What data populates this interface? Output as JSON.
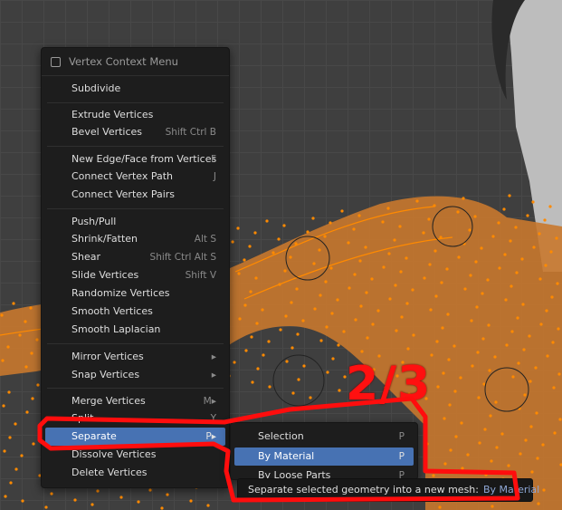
{
  "context_menu": {
    "title": "Vertex Context Menu",
    "items": [
      {
        "label": "Subdivide",
        "shortcut": ""
      },
      {
        "label": "Extrude Vertices",
        "shortcut": ""
      },
      {
        "label": "Bevel Vertices",
        "shortcut": "Shift Ctrl B"
      },
      {
        "label": "New Edge/Face from Vertices",
        "shortcut": "F"
      },
      {
        "label": "Connect Vertex Path",
        "shortcut": "J"
      },
      {
        "label": "Connect Vertex Pairs",
        "shortcut": ""
      },
      {
        "label": "Push/Pull",
        "shortcut": ""
      },
      {
        "label": "Shrink/Fatten",
        "shortcut": "Alt S"
      },
      {
        "label": "Shear",
        "shortcut": "Shift Ctrl Alt S"
      },
      {
        "label": "Slide Vertices",
        "shortcut": "Shift V"
      },
      {
        "label": "Randomize Vertices",
        "shortcut": ""
      },
      {
        "label": "Smooth Vertices",
        "shortcut": ""
      },
      {
        "label": "Smooth Laplacian",
        "shortcut": ""
      },
      {
        "label": "Mirror Vertices",
        "shortcut": "▸"
      },
      {
        "label": "Snap Vertices",
        "shortcut": "▸"
      },
      {
        "label": "Merge Vertices",
        "shortcut": "M▸"
      },
      {
        "label": "Split",
        "shortcut": "Y"
      },
      {
        "label": "Separate",
        "shortcut": "P▸"
      },
      {
        "label": "Dissolve Vertices",
        "shortcut": ""
      },
      {
        "label": "Delete Vertices",
        "shortcut": ""
      }
    ]
  },
  "separate_submenu": {
    "items": [
      {
        "label": "Selection",
        "shortcut": "P"
      },
      {
        "label": "By Material",
        "shortcut": "P"
      },
      {
        "label": "By Loose Parts",
        "shortcut": "P"
      }
    ]
  },
  "tooltip": {
    "text": "Separate selected geometry into a new mesh:",
    "value": "By Material"
  },
  "annotation": {
    "step_label": "2/3",
    "color": "#ff1010"
  },
  "colors": {
    "mesh_fill": "#c8782d",
    "wireframe": "#ff8a00",
    "highlight": "#4772b3"
  }
}
